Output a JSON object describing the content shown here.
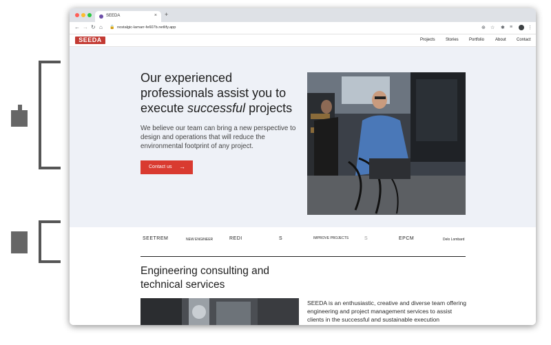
{
  "browser": {
    "tab_title": "SEEDA",
    "tab_close": "×",
    "new_tab": "+",
    "url": "nostalgic-lamarr-fe607b.netlify.app",
    "traffic_colors": [
      "#ff5f57",
      "#febc2e",
      "#28c840"
    ]
  },
  "site": {
    "logo_text": "SEEDA",
    "brand_color": "#c33a33",
    "nav": [
      "Projects",
      "Stories",
      "Portfolio",
      "About",
      "Contact"
    ]
  },
  "hero": {
    "title_line1": "Our experienced",
    "title_line2": "professionals assist you to",
    "title_line3_pre": "execute ",
    "title_line3_em": "successful",
    "title_line3_post": " projects",
    "lead": "We believe our team can bring a new perspective to design and operations that will reduce the environmental footprint of any project.",
    "cta_label": "Contact us",
    "cta_arrow": "→",
    "accent": "#d93a30",
    "background": "#eef1f7"
  },
  "partners": [
    "SEETREM",
    "NEW ENGINEER",
    "REDI",
    "S",
    "IMPROVE PROJECTS",
    "S",
    "EPCM",
    "Delo Lombard"
  ],
  "services": {
    "heading": "Engineering consulting and technical services",
    "body": "SEEDA is an enthusiastic, creative and diverse team offering engineering and project management services to assist clients in the successful and sustainable execution"
  }
}
